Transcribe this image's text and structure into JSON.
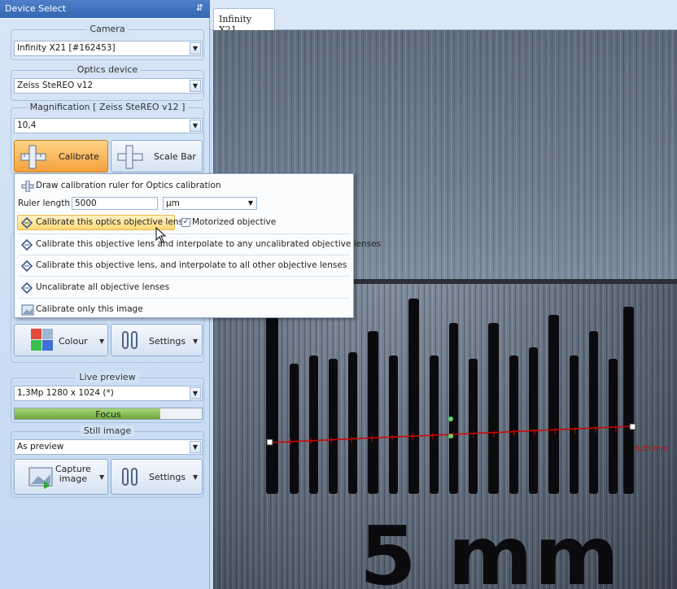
{
  "panel": {
    "title": "Device Select",
    "pin_glyph": "⇵"
  },
  "camera": {
    "title": "Camera",
    "value": "Infinity X21  [#162453]"
  },
  "optics": {
    "title": "Optics device",
    "value": "Zeiss SteREO v12"
  },
  "magnification": {
    "title": "Magnification [ Zeiss SteREO v12 ]",
    "value": "10,4",
    "calibrate_label": "Calibrate",
    "scalebar_label": "Scale Bar"
  },
  "image_group": {
    "colour_label": "Colour",
    "settings_label": "Settings"
  },
  "live_preview": {
    "title": "Live preview",
    "value": "1,3Mp 1280 x 1024 (*)",
    "focus_label": "Focus",
    "focus_level": 0.78
  },
  "still_image": {
    "title": "Still image",
    "value": "As preview",
    "capture_label_line1": "Capture",
    "capture_label_line2": "image",
    "settings_label": "Settings"
  },
  "viewer": {
    "tab_label": "Infinity X21",
    "measure_text": "5,35 mm",
    "overlay_text": "5 mm"
  },
  "popup": {
    "draw_label": "Draw calibration ruler for Optics calibration",
    "ruler_length_label": "Ruler length",
    "ruler_length_value": "5000",
    "unit_value": "µm",
    "calibrate_this_label": "Calibrate this optics objective lens",
    "motorized_label": "Motorized objective",
    "motorized_checked": "✓",
    "interp_uncal_label": "Calibrate this objective lens and interpolate to any uncalibrated objective lenses",
    "interp_all_label": "Calibrate this objective lens, and interpolate to all other objective lenses",
    "uncalibrate_label": "Uncalibrate all objective lenses",
    "calibrate_image_label": "Calibrate only this image"
  },
  "colors": {
    "accent": "#3566b3",
    "active_button": "#f5a13c",
    "measure_line": "#d40000"
  }
}
